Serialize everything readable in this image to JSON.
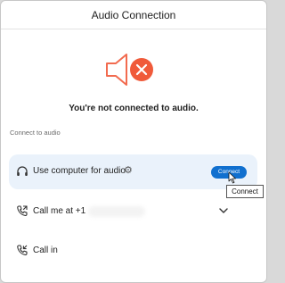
{
  "dialog": {
    "title": "Audio Connection"
  },
  "status": {
    "message": "You're not connected to audio.",
    "speaker_icon": "speaker-muted-icon",
    "speaker_color": "#f26b4f",
    "badge_color": "#f05a3a"
  },
  "options": {
    "section_label": "Connect to audio",
    "computer": {
      "label": "Use computer for audio",
      "icon": "headset-icon",
      "settings_icon": "gear-icon",
      "highlight_color": "#eaf2fb"
    },
    "call_me": {
      "label": "Call me at +1",
      "icon": "phone-outgoing-icon",
      "dropdown_icon": "chevron-down-icon"
    },
    "call_in": {
      "label": "Call in",
      "icon": "phone-incoming-icon"
    }
  },
  "connect_button": {
    "label": "Connect",
    "color": "#1170cf"
  },
  "tooltip": {
    "text": "Connect"
  }
}
